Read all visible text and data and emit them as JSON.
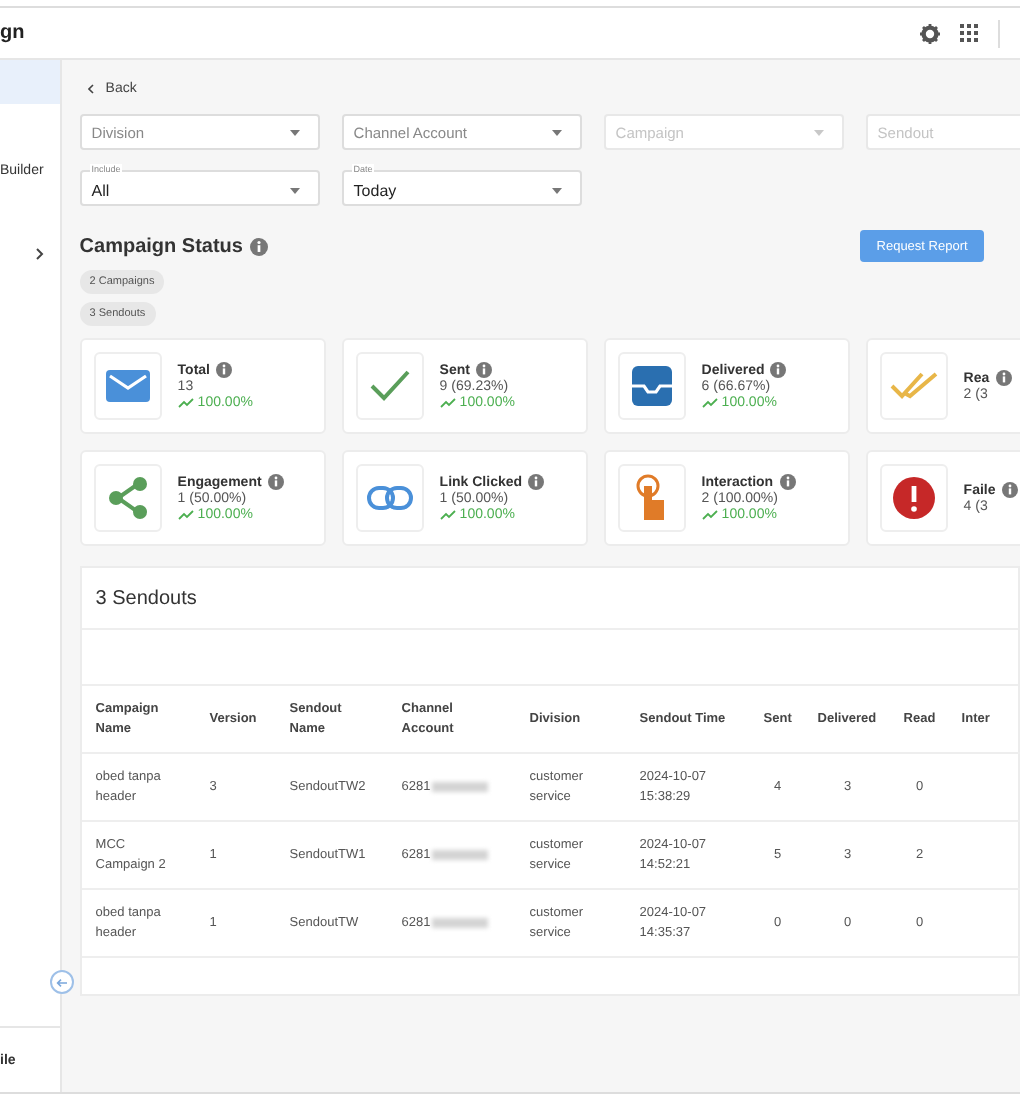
{
  "header": {
    "title": "gn"
  },
  "sidebar": {
    "items": [
      {
        "selected": true
      },
      {
        "label": "Builder",
        "selected": false
      },
      {
        "selected": false,
        "expandable": true
      }
    ],
    "footer": "ile"
  },
  "back": "Back",
  "filters": [
    {
      "placeholder": "Division",
      "disabled": false
    },
    {
      "placeholder": "Channel Account",
      "disabled": false
    },
    {
      "placeholder": "Campaign",
      "disabled": true
    },
    {
      "placeholder": "Sendout",
      "disabled": true
    }
  ],
  "selects": [
    {
      "label": "Include",
      "value": "All"
    },
    {
      "label": "Date",
      "value": "Today"
    }
  ],
  "status": {
    "title": "Campaign Status",
    "chips": [
      "2 Campaigns",
      "3 Sendouts"
    ],
    "button": "Request Report"
  },
  "cards": [
    {
      "kind": "mail",
      "title": "Total",
      "value": "13",
      "trend": "100.00%"
    },
    {
      "kind": "check",
      "title": "Sent",
      "value": "9 (69.23%)",
      "trend": "100.00%"
    },
    {
      "kind": "inbox",
      "title": "Delivered",
      "value": "6 (66.67%)",
      "trend": "100.00%"
    },
    {
      "kind": "double-check",
      "title": "Rea",
      "value": "2 (3"
    },
    {
      "kind": "share",
      "title": "Engagement",
      "value": "1 (50.00%)",
      "trend": "100.00%"
    },
    {
      "kind": "link",
      "title": "Link Clicked",
      "value": "1 (50.00%)",
      "trend": "100.00%"
    },
    {
      "kind": "touch",
      "title": "Interaction",
      "value": "2 (100.00%)",
      "trend": "100.00%"
    },
    {
      "kind": "alert",
      "title": "Faile",
      "value": "4 (3"
    }
  ],
  "table": {
    "title": "3 Sendouts",
    "columns": [
      "Campaign Name",
      "Version",
      "Sendout Name",
      "Channel Account",
      "Division",
      "Sendout Time",
      "Sent",
      "Delivered",
      "Read",
      "Inter"
    ],
    "rows": [
      {
        "campaign": "obed tanpa header",
        "version": "3",
        "sendout": "SendoutTW2",
        "account": "6281",
        "masked": true,
        "division": "customer service",
        "time": "2024-10-07 15:38:29",
        "sent": "4",
        "delivered": "3",
        "read": "0"
      },
      {
        "campaign": "MCC Campaign 2",
        "version": "1",
        "sendout": "SendoutTW1",
        "account": "6281",
        "masked": true,
        "division": "customer service",
        "time": "2024-10-07 14:52:21",
        "sent": "5",
        "delivered": "3",
        "read": "2"
      },
      {
        "campaign": "obed tanpa header",
        "version": "1",
        "sendout": "SendoutTW",
        "account": "6281",
        "masked": true,
        "division": "customer service",
        "time": "2024-10-07 14:35:37",
        "sent": "0",
        "delivered": "0",
        "read": "0"
      }
    ]
  }
}
